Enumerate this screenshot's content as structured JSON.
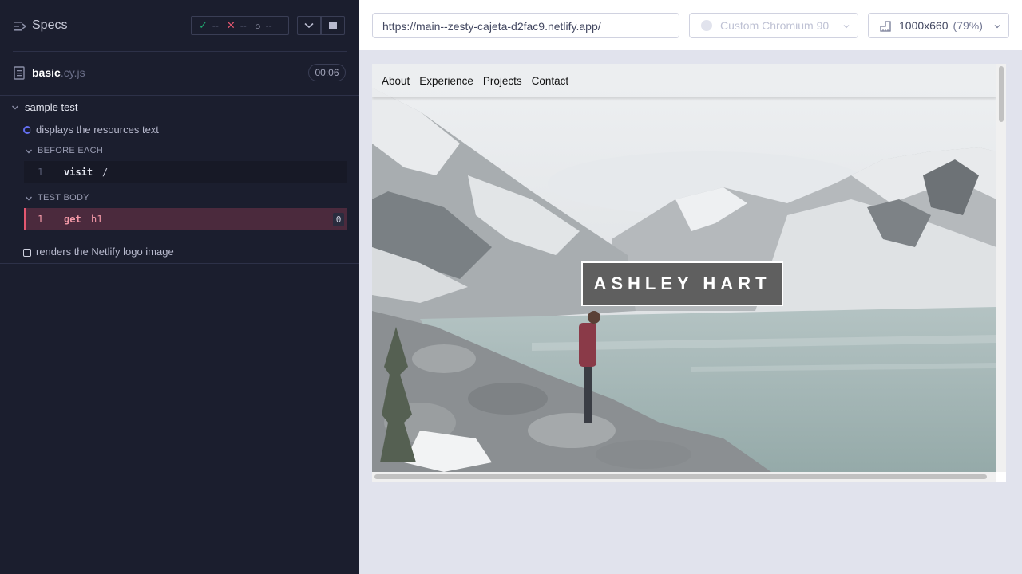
{
  "reporter": {
    "title": "Specs",
    "stats": {
      "passed": "--",
      "failed": "--",
      "pending": "--"
    },
    "file": {
      "name": "basic",
      "ext": ".cy.js",
      "duration": "00:06"
    },
    "suite": {
      "title": "sample test",
      "tests": [
        {
          "title": "displays the resources text",
          "state": "running",
          "hooks": [
            {
              "label": "BEFORE EACH",
              "commands": [
                {
                  "num": "1",
                  "name": "visit",
                  "arg": "/"
                }
              ]
            },
            {
              "label": "TEST BODY",
              "commands": [
                {
                  "num": "1",
                  "name": "get",
                  "arg": "h1",
                  "count": "0"
                }
              ]
            }
          ]
        },
        {
          "title": "renders the Netlify logo image",
          "state": "pending"
        }
      ]
    }
  },
  "aut": {
    "url": "https://main--zesty-cajeta-d2fac9.netlify.app/",
    "browser": "Custom Chromium 90",
    "viewport": "1000x660",
    "scale": "(79%)"
  },
  "site": {
    "nav": [
      "About",
      "Experience",
      "Projects",
      "Contact"
    ],
    "hero_title": "ASHLEY HART"
  },
  "colors": {
    "reporter_bg": "#1b1e2e",
    "pass": "#1fa971",
    "fail": "#e45770",
    "running": "#6470f3",
    "failed_cmd_bg": "#4b2a3d"
  }
}
